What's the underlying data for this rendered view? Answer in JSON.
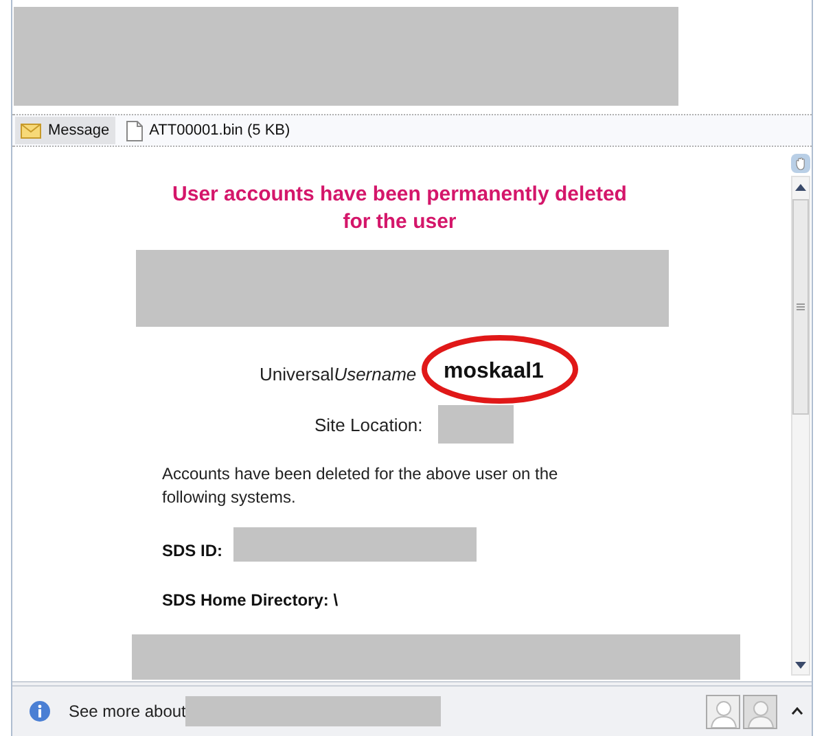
{
  "attachment_bar": {
    "tabs": [
      {
        "label": "Message",
        "kind": "message",
        "selected": true
      },
      {
        "label": "ATT00001.bin (5 KB)",
        "kind": "file",
        "selected": false
      }
    ]
  },
  "message": {
    "heading": "User accounts have been permanently deleted for the user",
    "username_label": "Universal",
    "username_label_italic": "Username",
    "username": "moskaal1",
    "site_location_label": "Site Location:",
    "body": "Accounts have been deleted for the above user on the following systems.",
    "sds_id_label": "SDS ID:",
    "sds_home_label": "SDS Home Directory: \\"
  },
  "people_pane": {
    "text": "See more about"
  }
}
